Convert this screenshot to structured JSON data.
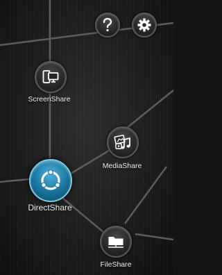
{
  "toolbar": {
    "help_icon": "question-mark-icon",
    "settings_icon": "gear-icon"
  },
  "nodes": {
    "screen_share": {
      "label": "ScreenShare",
      "icon": "screen-mirror-icon"
    },
    "media_share": {
      "label": "MediaShare",
      "icon": "media-icon"
    },
    "direct_share": {
      "label": "DirectShare",
      "icon": "direct-ring-icon",
      "selected": true,
      "accent": "#1a7aa6"
    },
    "file_share": {
      "label": "FileShare",
      "icon": "folder-icon"
    }
  },
  "colors": {
    "connector": "#6a6a6a",
    "background": "#1b1b1b",
    "accent": "#1a7aa6"
  }
}
